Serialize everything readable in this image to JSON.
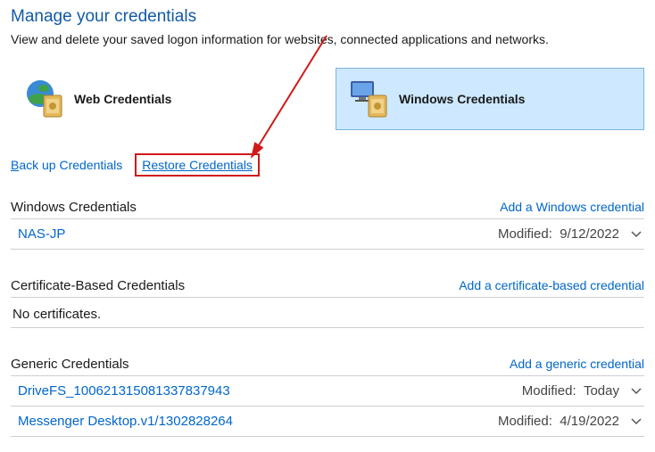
{
  "title": "Manage your credentials",
  "subtitle": "View and delete your saved logon information for websites, connected applications and networks.",
  "types": {
    "web": {
      "label": "Web Credentials",
      "active": false
    },
    "windows": {
      "label": "Windows Credentials",
      "active": true
    }
  },
  "actions": {
    "backup": "Back up Credentials",
    "restore": "Restore Credentials"
  },
  "sections": {
    "windows": {
      "title": "Windows Credentials",
      "add": "Add a Windows credential",
      "items": [
        {
          "name": "NAS-JP",
          "modified_label": "Modified:",
          "modified_value": "9/12/2022"
        }
      ]
    },
    "cert": {
      "title": "Certificate-Based Credentials",
      "add": "Add a certificate-based credential",
      "empty": "No certificates.",
      "items": []
    },
    "generic": {
      "title": "Generic Credentials",
      "add": "Add a generic credential",
      "items": [
        {
          "name": "DriveFS_100621315081337837943",
          "modified_label": "Modified:",
          "modified_value": "Today"
        },
        {
          "name": "Messenger Desktop.v1/1302828264",
          "modified_label": "Modified:",
          "modified_value": "4/19/2022"
        }
      ]
    }
  }
}
